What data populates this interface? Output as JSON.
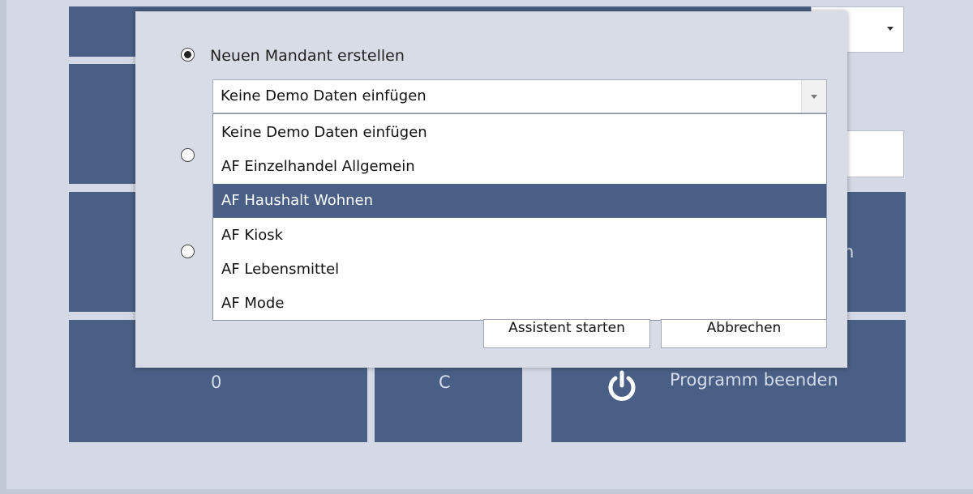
{
  "dialog": {
    "option_new_client_label": "Neuen Mandant erstellen",
    "demo_data_combo": {
      "selected_value": "Keine Demo Daten einfügen",
      "options": [
        "Keine Demo Daten einfügen",
        "AF Einzelhandel Allgemein",
        "AF Haushalt Wohnen",
        "AF Kiosk",
        "AF Lebensmittel",
        "AF Mode"
      ],
      "highlighted_option": "AF Haushalt Wohnen"
    },
    "start_wizard_label": "Assistent starten",
    "cancel_label": "Abbrechen"
  },
  "keypad": {
    "key_zero": "0",
    "key_clear": "C",
    "exit_label": "Programm beenden",
    "partial_label_n": "n"
  },
  "colors": {
    "tile": "#4a5f85",
    "background": "#d5d9e5",
    "highlight": "#4a5f85"
  },
  "icons": {
    "power": "power-icon"
  }
}
